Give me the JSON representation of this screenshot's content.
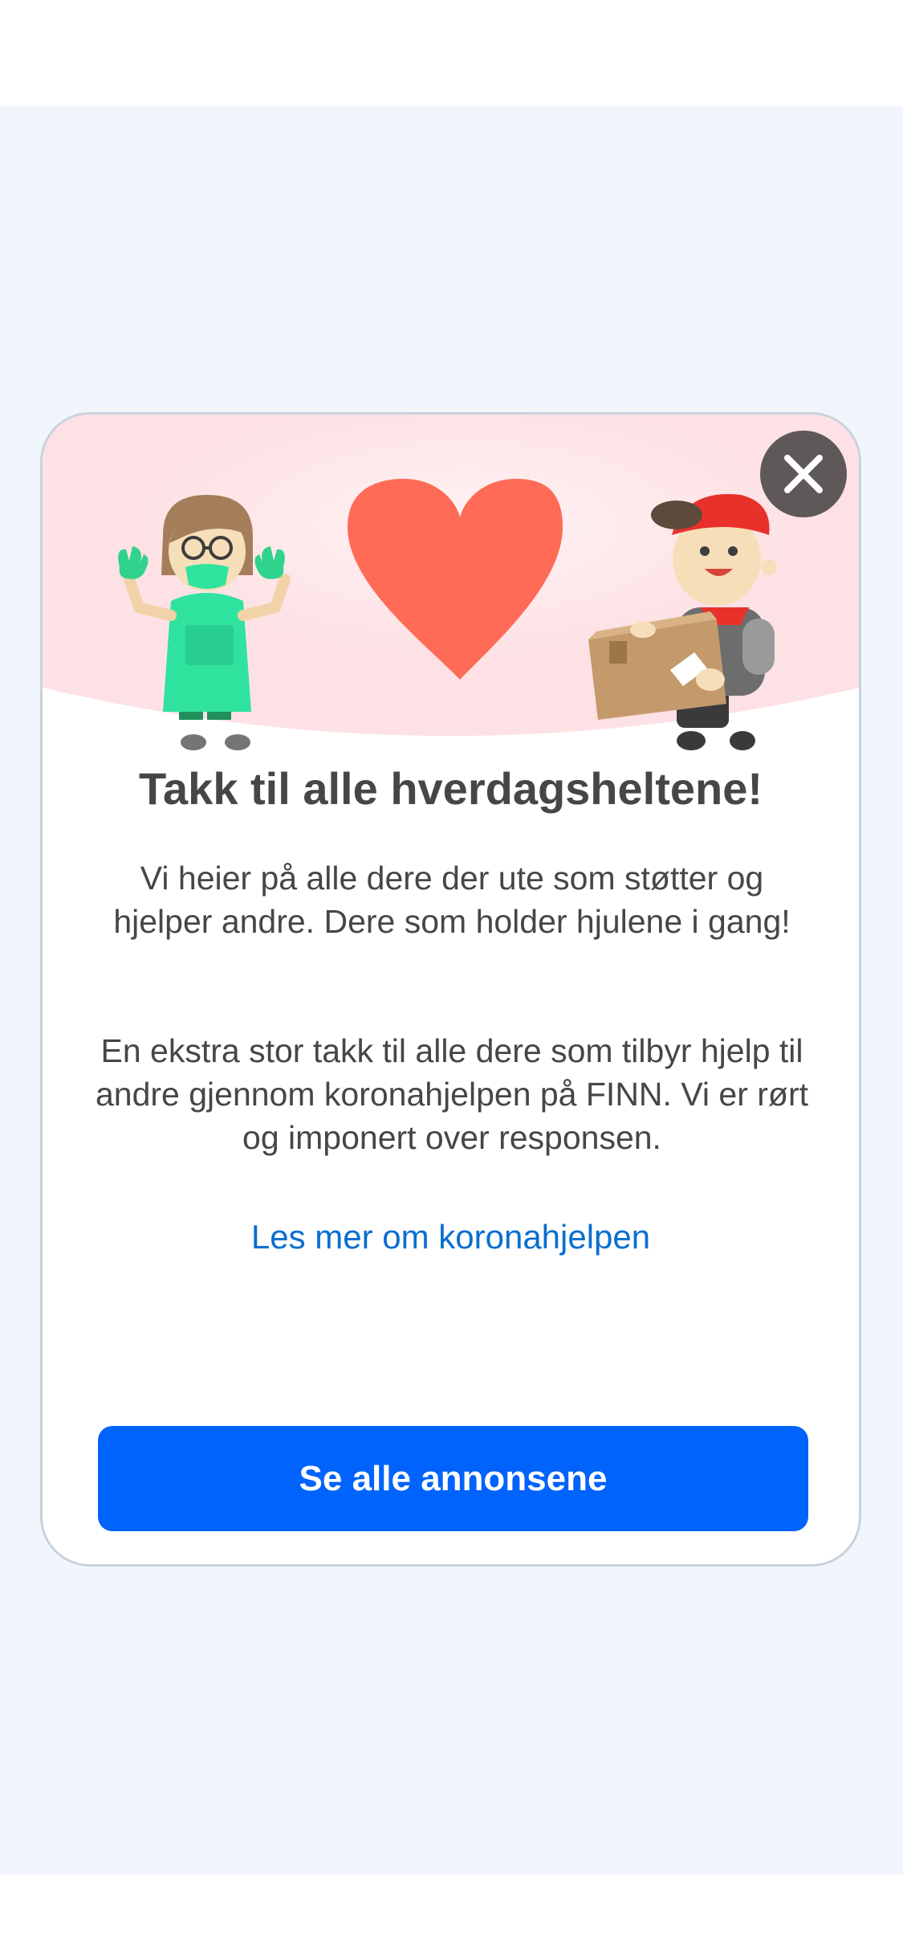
{
  "modal": {
    "title": "Takk til alle hverdagsheltene!",
    "paragraph_1": "Vi heier på alle dere der ute som støtter og hjelper andre. Dere som holder hjulene i gang!",
    "paragraph_2": "En ekstra stor takk til alle dere som tilbyr hjelp til andre gjennom koronahjelpen på FINN. Vi er rørt og imponert over responsen.",
    "link_label": "Les mer om koronahjelpen",
    "cta_label": "Se alle annonsene",
    "close_icon": "close-icon"
  },
  "colors": {
    "backdrop": "#f1f6fd",
    "hero_background": "#fde1e5",
    "heart": "#ff6b57",
    "link": "#0a6ed1",
    "cta": "#0063fb",
    "close_button": "#5f5858"
  }
}
